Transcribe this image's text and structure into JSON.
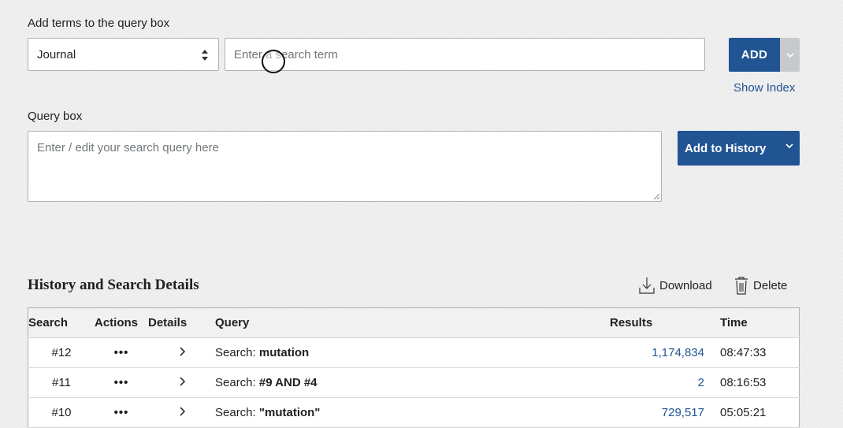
{
  "add_terms": {
    "heading": "Add terms to the query box",
    "field_select_value": "Journal",
    "term_placeholder": "Enter a search term",
    "add_button": "ADD",
    "show_index_link": "Show Index"
  },
  "query_box": {
    "heading": "Query box",
    "placeholder": "Enter / edit your search query here",
    "add_to_history_button": "Add to History"
  },
  "history": {
    "title": "History and Search Details",
    "download_label": "Download",
    "delete_label": "Delete",
    "columns": [
      "Search",
      "Actions",
      "Details",
      "Query",
      "Results",
      "Time"
    ],
    "rows": [
      {
        "search": "#12",
        "actions": "•••",
        "query_prefix": "Search: ",
        "query_term": "mutation",
        "results": "1,174,834",
        "time": "08:47:33"
      },
      {
        "search": "#11",
        "actions": "•••",
        "query_prefix": "Search: ",
        "query_term": "#9 AND #4",
        "results": "2",
        "time": "08:16:53"
      },
      {
        "search": "#10",
        "actions": "•••",
        "query_prefix": "Search: ",
        "query_term": "\"mutation\"",
        "results": "729,517",
        "time": "05:05:21"
      }
    ]
  },
  "colors": {
    "primary": "#205493",
    "link": "#205493",
    "background": "#ececec"
  }
}
